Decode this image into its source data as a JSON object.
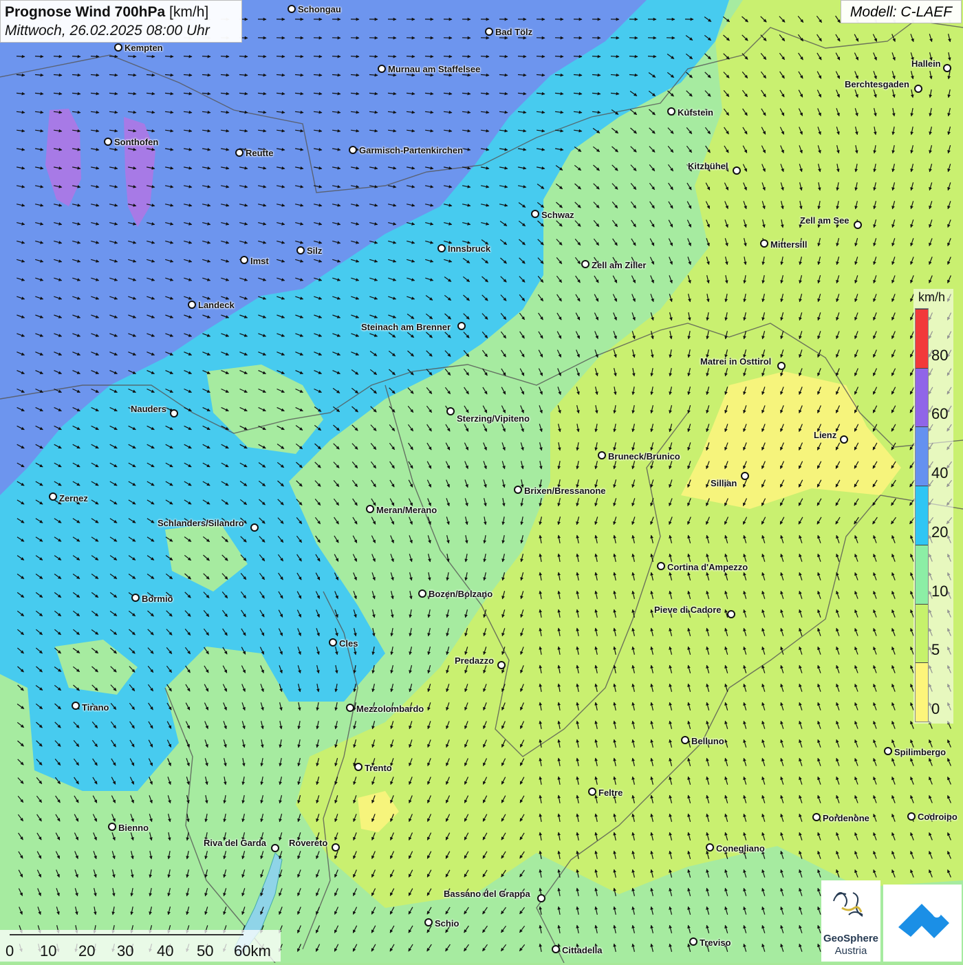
{
  "header": {
    "title_bold": "Prognose Wind 700hPa",
    "title_unit": "[km/h]",
    "subtitle": "Mittwoch, 26.02.2025 08:00 Uhr",
    "model": "Modell: C-LAEF"
  },
  "legend": {
    "unit": "km/h",
    "bands": [
      {
        "label": "0",
        "color": "#fdf57a"
      },
      {
        "label": "5",
        "color": "#c6f26b"
      },
      {
        "label": "10",
        "color": "#8ceea5"
      },
      {
        "label": "20",
        "color": "#2fc6f4"
      },
      {
        "label": "40",
        "color": "#6591f0"
      },
      {
        "label": "60",
        "color": "#9065e8"
      },
      {
        "label": "80",
        "color": "#f2393a"
      }
    ]
  },
  "scale_bar": {
    "labels": [
      "0",
      "10",
      "20",
      "30",
      "40",
      "50",
      "60km"
    ]
  },
  "cities": [
    {
      "name": "Schongau"
    },
    {
      "name": "Bad Tölz"
    },
    {
      "name": "Kempten"
    },
    {
      "name": "Murnau am Staffelsee"
    },
    {
      "name": "Hallein"
    },
    {
      "name": "Berchtesgaden"
    },
    {
      "name": "Kufstein"
    },
    {
      "name": "Sonthofen"
    },
    {
      "name": "Reutte"
    },
    {
      "name": "Garmisch-Partenkirchen"
    },
    {
      "name": "Kitzbühel"
    },
    {
      "name": "Schwaz"
    },
    {
      "name": "Zell am See"
    },
    {
      "name": "Mittersill"
    },
    {
      "name": "Innsbruck"
    },
    {
      "name": "Imst"
    },
    {
      "name": "Silz"
    },
    {
      "name": "Zell am Ziller"
    },
    {
      "name": "Landeck"
    },
    {
      "name": "Steinach am Brenner"
    },
    {
      "name": "Matrei in Osttirol"
    },
    {
      "name": "Nauders"
    },
    {
      "name": "Sterzing/Vipiteno"
    },
    {
      "name": "Lienz"
    },
    {
      "name": "Bruneck/Brunico"
    },
    {
      "name": "Sillian"
    },
    {
      "name": "Brixen/Bressanone"
    },
    {
      "name": "Zernez"
    },
    {
      "name": "Meran/Merano"
    },
    {
      "name": "Schlanders/Silandro"
    },
    {
      "name": "Cortina d'Ampezzo"
    },
    {
      "name": "Bozen/Bolzano"
    },
    {
      "name": "Bormio"
    },
    {
      "name": "Pieve di Cadore"
    },
    {
      "name": "Cles"
    },
    {
      "name": "Predazzo"
    },
    {
      "name": "Tirano"
    },
    {
      "name": "Mezzolombardo"
    },
    {
      "name": "Belluno"
    },
    {
      "name": "Spilimbergo"
    },
    {
      "name": "Trento"
    },
    {
      "name": "Feltre"
    },
    {
      "name": "Pordenone"
    },
    {
      "name": "Codroipo"
    },
    {
      "name": "Bienno"
    },
    {
      "name": "Riva del Garda"
    },
    {
      "name": "Rovereto"
    },
    {
      "name": "Conegliano"
    },
    {
      "name": "Bassano del Grappa"
    },
    {
      "name": "Schio"
    },
    {
      "name": "Treviso"
    },
    {
      "name": "Cittadella"
    }
  ],
  "logos": {
    "geosphere_line1": "GeoSphere",
    "geosphere_line2": "Austria"
  }
}
